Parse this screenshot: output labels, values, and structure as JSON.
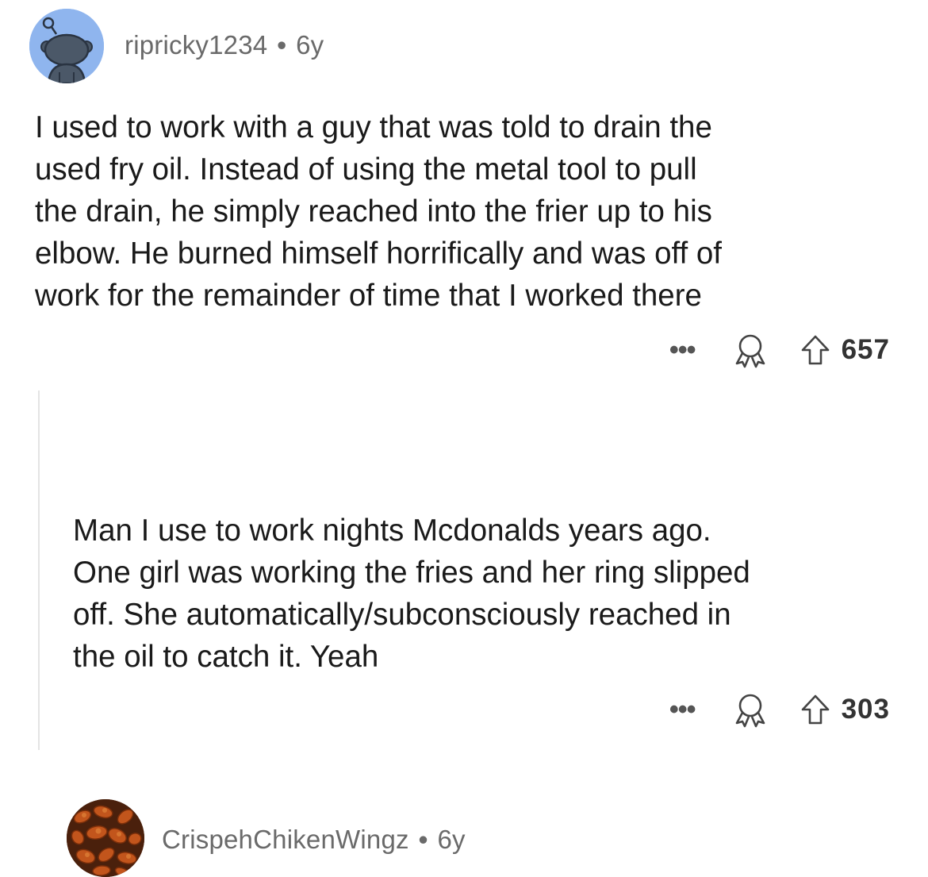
{
  "comments": [
    {
      "username": "ripricky1234",
      "separator": "•",
      "age": "6y",
      "body_lines": [
        "I used to work with a guy that was told to drain the",
        "used fry oil. Instead of using the metal tool to pull",
        "the drain, he simply reached into the frier up to his",
        "elbow. He burned himself horrifically and was off of",
        "work for the remainder of time that I worked there"
      ],
      "more_label": "•••",
      "score": "657",
      "avatar_icon": "reddit-default-snoo-avatar",
      "award_icon": "award-icon",
      "upvote_icon": "upvote-arrow-icon"
    },
    {
      "username": "CrispehChikenWingz",
      "separator": "•",
      "age": "6y",
      "body_lines": [
        "Man I use to work nights Mcdonalds years ago.",
        "One girl was working the fries and her ring slipped",
        "off. She automatically/subconsciously reached in",
        "the oil to catch it. Yeah"
      ],
      "more_label": "•••",
      "score": "303",
      "avatar_icon": "fried-chicken-wings-avatar",
      "award_icon": "award-icon",
      "upvote_icon": "upvote-arrow-icon"
    }
  ],
  "colors": {
    "background": "#ffffff",
    "text": "#1a1a1a",
    "meta_text": "#6a6a6a",
    "snoo_avatar_bg": "#8fb5ee",
    "thread_line": "#e4e4e4"
  }
}
